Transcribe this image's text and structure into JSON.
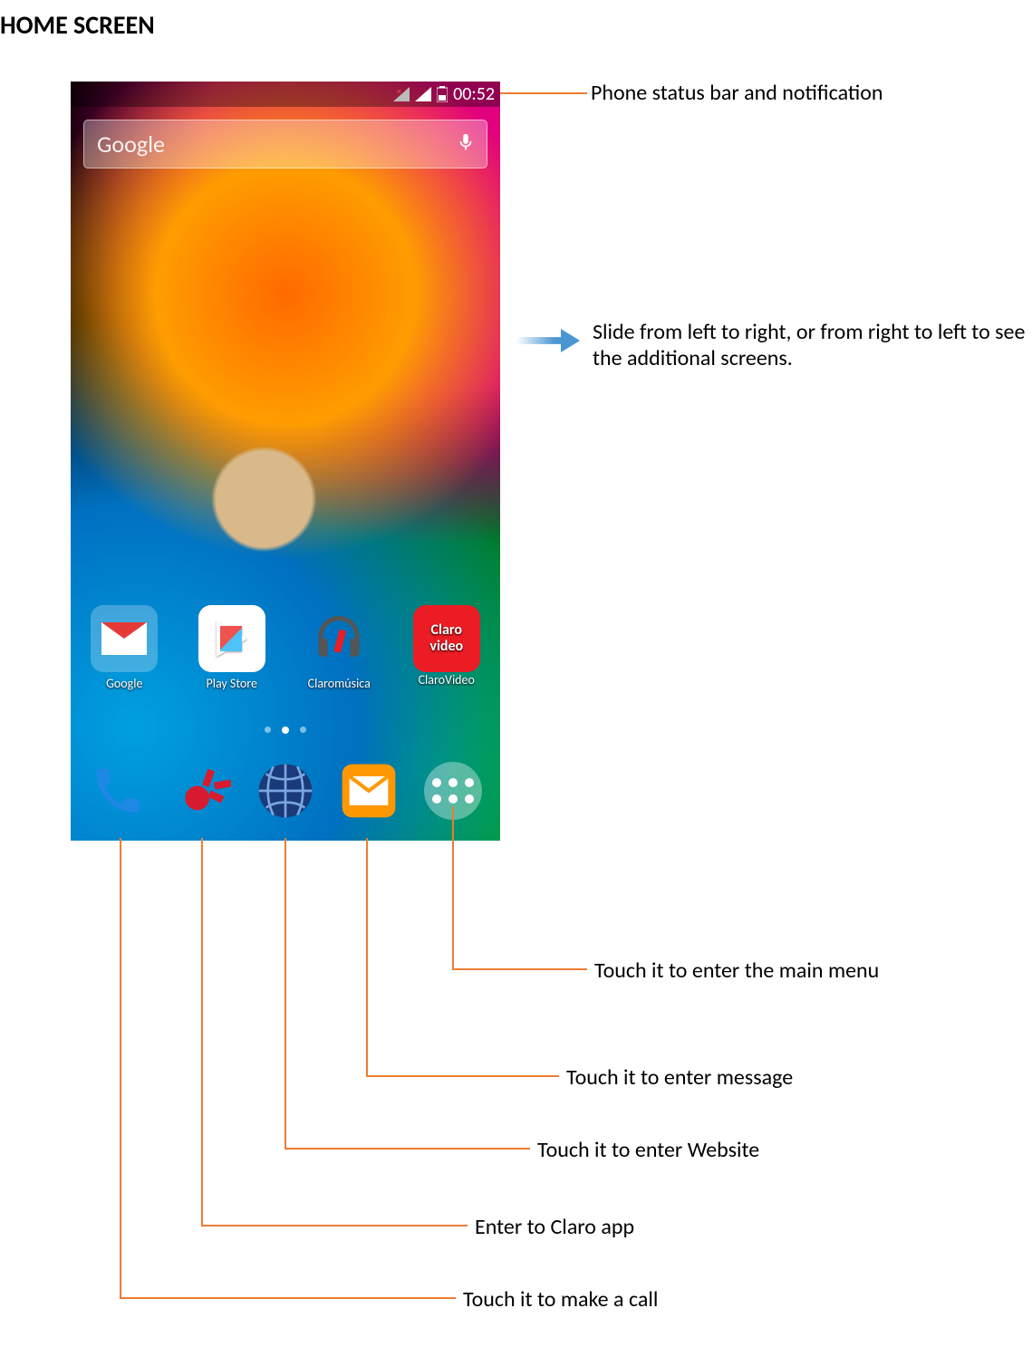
{
  "title": "HOME SCREEN",
  "status": {
    "time": "00:52"
  },
  "search": {
    "placeholder": "Google"
  },
  "apps": [
    {
      "label": "Google"
    },
    {
      "label": "Play Store"
    },
    {
      "label": "Claromúsica"
    },
    {
      "label": "ClaroVideo"
    }
  ],
  "claro_video_text": "Claro video",
  "callouts": {
    "status_bar": "Phone status bar and notification",
    "slide": "Slide from left to right, or from right to left to see the additional screens.",
    "main_menu": "Touch it to enter the main menu",
    "message": "Touch it to enter message",
    "website": "Touch it to enter Website",
    "claro_app": "Enter to Claro app",
    "call": "Touch it to make a call"
  }
}
